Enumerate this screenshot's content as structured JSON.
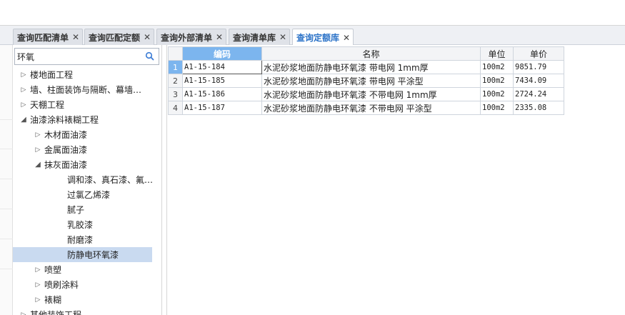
{
  "tabs": [
    {
      "label": "查询匹配清单",
      "active": false
    },
    {
      "label": "查询匹配定额",
      "active": false
    },
    {
      "label": "查询外部清单",
      "active": false
    },
    {
      "label": "查询清单库",
      "active": false
    },
    {
      "label": "查询定额库",
      "active": true
    }
  ],
  "tab_close_glyph": "✕",
  "search": {
    "value": "环氧",
    "icon": "search-icon"
  },
  "tree": [
    {
      "label": "楼地面工程",
      "level": 0,
      "state": "collapsed"
    },
    {
      "label": "墙、柱面装饰与隔断、幕墙…",
      "level": 0,
      "state": "collapsed"
    },
    {
      "label": "天棚工程",
      "level": 0,
      "state": "collapsed"
    },
    {
      "label": "油漆涂料裱糊工程",
      "level": 0,
      "state": "expanded"
    },
    {
      "label": "木材面油漆",
      "level": 1,
      "state": "collapsed"
    },
    {
      "label": "金属面油漆",
      "level": 1,
      "state": "collapsed"
    },
    {
      "label": "抹灰面油漆",
      "level": 1,
      "state": "expanded"
    },
    {
      "label": "调和漆、真石漆、氟…",
      "level": 2,
      "state": "leaf"
    },
    {
      "label": "过氯乙烯漆",
      "level": 2,
      "state": "leaf"
    },
    {
      "label": "腻子",
      "level": 2,
      "state": "leaf"
    },
    {
      "label": "乳胶漆",
      "level": 2,
      "state": "leaf"
    },
    {
      "label": "耐磨漆",
      "level": 2,
      "state": "leaf"
    },
    {
      "label": "防静电环氧漆",
      "level": 2,
      "state": "leaf",
      "selected": true
    },
    {
      "label": "喷塑",
      "level": 1,
      "state": "collapsed"
    },
    {
      "label": "喷刷涂料",
      "level": 1,
      "state": "collapsed"
    },
    {
      "label": "裱糊",
      "level": 1,
      "state": "collapsed"
    },
    {
      "label": "其他装饰工程",
      "level": 0,
      "state": "collapsed"
    }
  ],
  "grid": {
    "columns": [
      "编码",
      "名称",
      "单位",
      "单价"
    ],
    "rows": [
      {
        "num": "1",
        "code": "A1-15-184",
        "name": "水泥砂浆地面防静电环氧漆 带电网 1mm厚",
        "unit": "100m2",
        "price": "9851.79"
      },
      {
        "num": "2",
        "code": "A1-15-185",
        "name": "水泥砂浆地面防静电环氧漆 带电网 平涂型",
        "unit": "100m2",
        "price": "7434.09"
      },
      {
        "num": "3",
        "code": "A1-15-186",
        "name": "水泥砂浆地面防静电环氧漆 不带电网 1mm厚",
        "unit": "100m2",
        "price": "2724.24"
      },
      {
        "num": "4",
        "code": "A1-15-187",
        "name": "水泥砂浆地面防静电环氧漆 不带电网 平涂型",
        "unit": "100m2",
        "price": "2335.08"
      }
    ]
  },
  "colors": {
    "accent": "#2c73c8",
    "selected_header": "#7cb5ee",
    "tree_selected": "#c9daf0"
  }
}
